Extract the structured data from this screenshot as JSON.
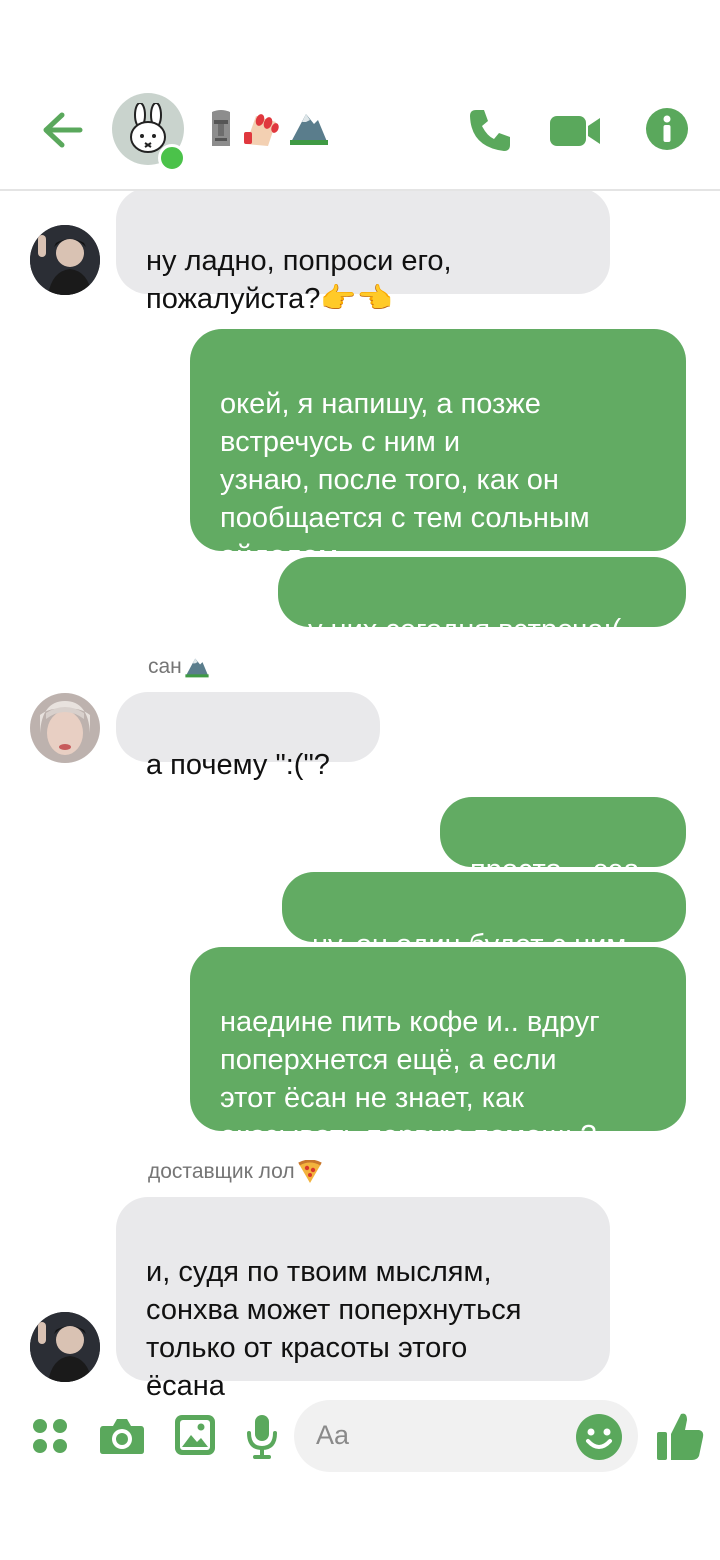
{
  "colors": {
    "accent": "#5aa85c",
    "outgoing_bubble": "#62ab63",
    "incoming_bubble": "#e9e9eb",
    "online": "#4bc24a"
  },
  "header": {
    "back_icon": "arrow-left-icon",
    "avatar_icon": "bunny-icon",
    "title_emojis": [
      "moai-emoji",
      "nail-polish-emoji",
      "mountain-emoji"
    ],
    "actions": [
      "phone-icon",
      "video-camera-icon",
      "info-icon"
    ]
  },
  "messages": [
    {
      "side": "in",
      "text": "ну ладно, попроси его,\nпожалуйста?",
      "emoji": "👉👈"
    },
    {
      "side": "out",
      "text": "окей, я напишу, а позже\nвстречусь с ним и\nузнаю, после того, как он\nпообщается с тем сольным\nайдолом"
    },
    {
      "side": "out",
      "text": "у них сегодня встреча:("
    },
    {
      "side": "in",
      "sender": "сан",
      "text": "а почему \":(\"?"
    },
    {
      "side": "out",
      "text": "просто... ээа"
    },
    {
      "side": "out",
      "text": "ну, он один будет с ним"
    },
    {
      "side": "out",
      "text": "наедине пить кофе и.. вдруг\nпоперхнется ещё, а если\nэтот ёсан не знает, как\nоказывать первую помощь?"
    },
    {
      "side": "in",
      "sender": "доставщик лол",
      "text": "и, судя по твоим мыслям,\nсонхва может поперхнуться\nтолько от красоты этого\nёсана"
    }
  ],
  "composer": {
    "placeholder": "Aa",
    "icons": [
      "apps-grid-icon",
      "camera-icon",
      "gallery-icon",
      "microphone-icon",
      "smiley-icon",
      "thumbs-up-icon"
    ]
  }
}
